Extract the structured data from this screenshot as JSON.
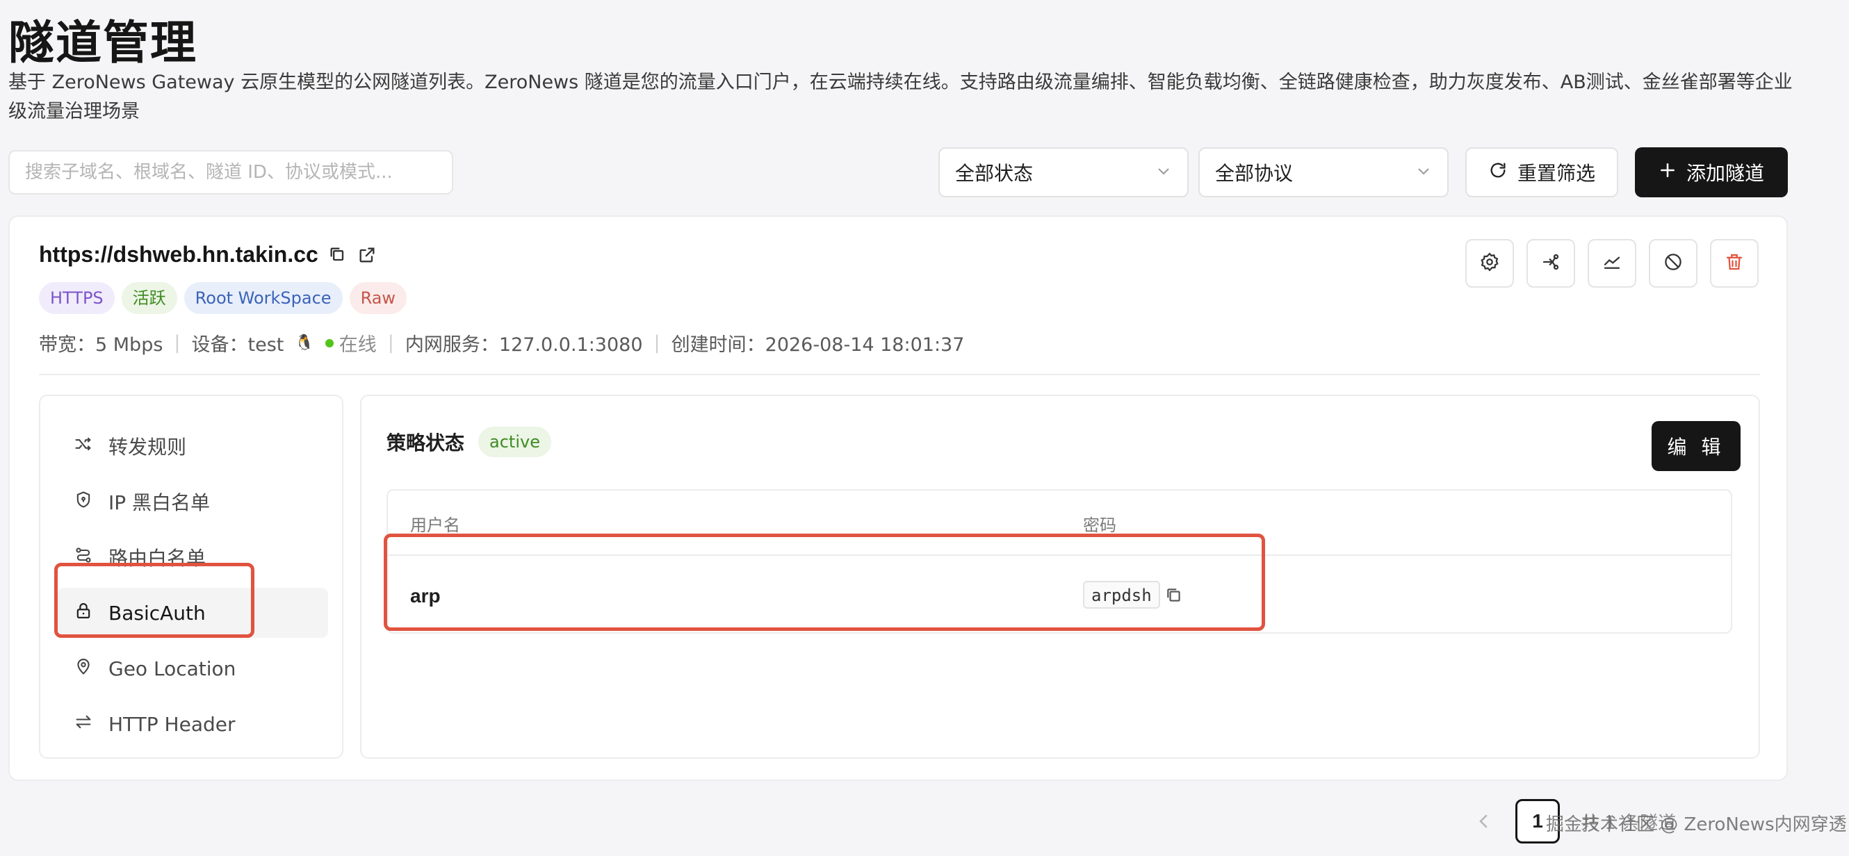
{
  "page": {
    "title": "隧道管理",
    "description": "基于 ZeroNews Gateway 云原生模型的公网隧道列表。ZeroNews 隧道是您的流量入口门户，在云端持续在线。支持路由级流量编排、智能负载均衡、全链路健康检查，助力灰度发布、AB测试、金丝雀部署等企业级流量治理场景"
  },
  "filters": {
    "search_placeholder": "搜索子域名、根域名、隧道 ID、协议或模式...",
    "status_select": "全部状态",
    "protocol_select": "全部协议",
    "reset_label": "重置筛选",
    "add_label": "添加隧道"
  },
  "tunnel": {
    "url": "https://dshweb.hn.takin.cc",
    "tags": [
      {
        "label": "HTTPS",
        "bg": "#f1ecfb",
        "color": "#7b55c7"
      },
      {
        "label": "活跃",
        "bg": "#ecf5e6",
        "color": "#3f8b23"
      },
      {
        "label": "Root WorkSpace",
        "bg": "#e8effb",
        "color": "#3c63b8"
      },
      {
        "label": "Raw",
        "bg": "#fbeceb",
        "color": "#c4574b"
      }
    ],
    "meta": {
      "bandwidth": "带宽：5 Mbps",
      "device": "设备：test",
      "device_os_icon": "🐧",
      "online": "在线",
      "online_color": "#52c41a",
      "service": "内网服务：127.0.0.1:3080",
      "created": "创建时间：2026-08-14 18:01:37"
    }
  },
  "sidebar": {
    "items": [
      {
        "label": "转发规则",
        "icon": "shuffle-icon"
      },
      {
        "label": "IP 黑白名单",
        "icon": "shield-icon"
      },
      {
        "label": "路由白名单",
        "icon": "route-icon"
      },
      {
        "label": "BasicAuth",
        "icon": "lock-icon",
        "active": true
      },
      {
        "label": "Geo Location",
        "icon": "location-pin-icon"
      },
      {
        "label": "HTTP Header",
        "icon": "arrows-icon"
      }
    ]
  },
  "policy": {
    "title": "策略状态",
    "status": "active",
    "edit_label": "编 辑",
    "columns": [
      "用户名",
      "密码"
    ],
    "rows": [
      {
        "username": "arp",
        "password": "arpdsh"
      }
    ]
  },
  "pagination": {
    "current": "1",
    "total_text": "共 1 条隧道"
  },
  "watermark": "掘金技术社区 @ ZeroNews内网穿透",
  "colors": {
    "accent_dark": "#161616",
    "highlight_red": "#e0533f"
  }
}
